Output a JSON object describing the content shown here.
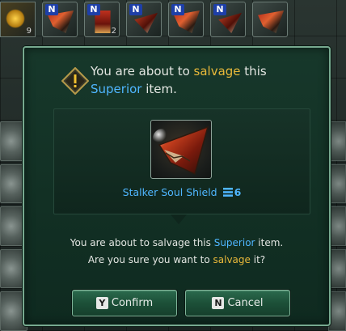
{
  "top_bar": {
    "first_slot_count": "9",
    "slots": [
      {
        "badge": "N",
        "count": ""
      },
      {
        "badge": "N",
        "count": "2"
      },
      {
        "badge": "N",
        "count": ""
      },
      {
        "badge": "N",
        "count": ""
      },
      {
        "badge": "N",
        "count": ""
      },
      {
        "badge": "",
        "count": ""
      }
    ]
  },
  "dialog": {
    "header_line1_prefix": "You are about to ",
    "header_line1_action": "salvage",
    "header_line1_suffix": " this",
    "header_line2_tier": "Superior",
    "header_line2_suffix": " item.",
    "item_name": "Stalker Soul Shield",
    "item_grade": "6",
    "body_line1_prefix": "You are about to salvage this ",
    "body_line1_tier": "Superior",
    "body_line1_suffix": " item.",
    "body_line2_prefix": "Are you sure you want to ",
    "body_line2_action": "salvage",
    "body_line2_suffix": " it?",
    "confirm_key": "Y",
    "confirm_label": "Confirm",
    "cancel_key": "N",
    "cancel_label": "Cancel"
  },
  "colors": {
    "accent_gold": "#e9b93a",
    "accent_blue": "#4fb6ff",
    "dialog_bg": "#123024",
    "dialog_border": "#77a98f",
    "button_green": "#1c5038"
  },
  "icons": {
    "warning": "warning-diamond-icon",
    "tier": "grade-bars-icon"
  }
}
